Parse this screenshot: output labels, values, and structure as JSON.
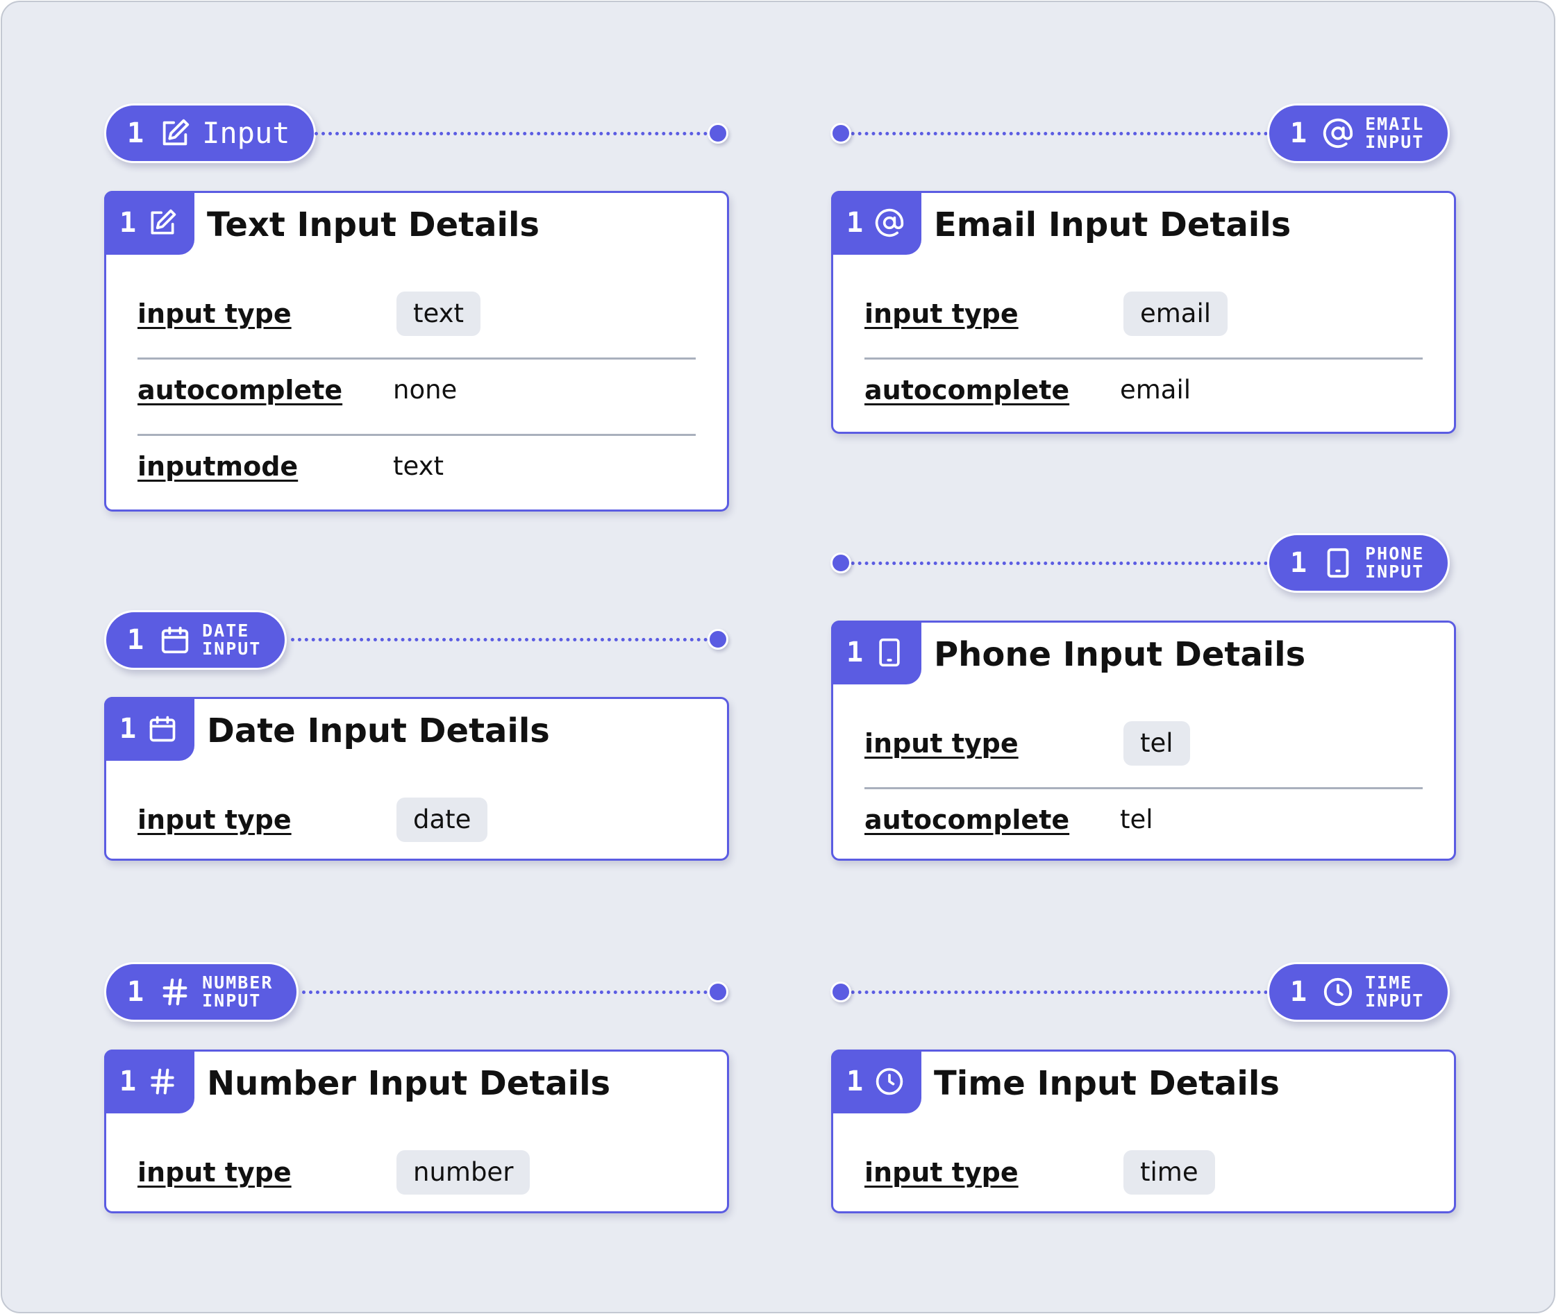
{
  "accent_color": "#5b5ce2",
  "cards": [
    {
      "key": "text",
      "tag": {
        "number": "1",
        "icon": "edit-icon",
        "line1": "Input",
        "line2": ""
      },
      "badge": {
        "number": "1",
        "icon": "edit-icon"
      },
      "title": "Text Input Details",
      "rows": [
        {
          "label": "input type",
          "value": "text",
          "style": "chip"
        },
        {
          "label": "autocomplete",
          "value": "none",
          "style": "plain"
        },
        {
          "label": "inputmode",
          "value": "text",
          "style": "plain"
        }
      ]
    },
    {
      "key": "email",
      "tag": {
        "number": "1",
        "icon": "at-sign-icon",
        "line1": "EMAIL",
        "line2": "INPUT"
      },
      "badge": {
        "number": "1",
        "icon": "at-sign-icon"
      },
      "title": "Email Input Details",
      "rows": [
        {
          "label": "input type",
          "value": "email",
          "style": "chip"
        },
        {
          "label": "autocomplete",
          "value": "email",
          "style": "plain"
        }
      ]
    },
    {
      "key": "date",
      "tag": {
        "number": "1",
        "icon": "calendar-icon",
        "line1": "DATE",
        "line2": "INPUT"
      },
      "badge": {
        "number": "1",
        "icon": "calendar-icon"
      },
      "title": "Date Input Details",
      "rows": [
        {
          "label": "input type",
          "value": "date",
          "style": "chip"
        }
      ]
    },
    {
      "key": "phone",
      "tag": {
        "number": "1",
        "icon": "phone-icon",
        "line1": "PHONE",
        "line2": "INPUT"
      },
      "badge": {
        "number": "1",
        "icon": "phone-icon"
      },
      "title": "Phone Input Details",
      "rows": [
        {
          "label": "input type",
          "value": "tel",
          "style": "chip"
        },
        {
          "label": "autocomplete",
          "value": "tel",
          "style": "plain"
        }
      ]
    },
    {
      "key": "number",
      "tag": {
        "number": "1",
        "icon": "hash-icon",
        "line1": "NUMBER",
        "line2": "INPUT"
      },
      "badge": {
        "number": "1",
        "icon": "hash-icon"
      },
      "title": "Number Input Details",
      "rows": [
        {
          "label": "input type",
          "value": "number",
          "style": "chip"
        }
      ]
    },
    {
      "key": "time",
      "tag": {
        "number": "1",
        "icon": "clock-icon",
        "line1": "TIME",
        "line2": "INPUT"
      },
      "badge": {
        "number": "1",
        "icon": "clock-icon"
      },
      "title": "Time Input Details",
      "rows": [
        {
          "label": "input type",
          "value": "time",
          "style": "chip"
        }
      ]
    }
  ]
}
